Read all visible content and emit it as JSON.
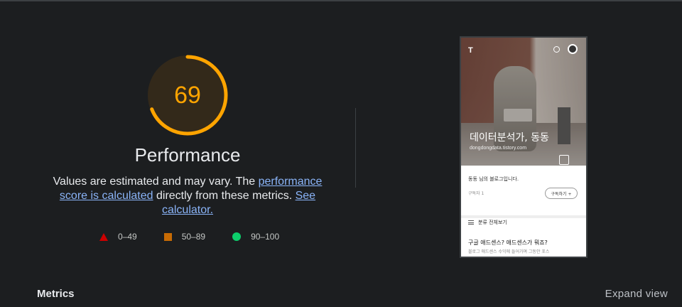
{
  "gauge": {
    "score": "69",
    "score_fraction": 0.69,
    "color": "#ffa400"
  },
  "category": {
    "title": "Performance"
  },
  "description": {
    "text_before": "Values are estimated and may vary. The ",
    "link1": "performance score is calculated",
    "text_middle": " directly from these metrics. ",
    "link2": "See calculator."
  },
  "legend": [
    {
      "label": "0–49",
      "icon": "red-triangle",
      "color": "#cc0000"
    },
    {
      "label": "50–89",
      "icon": "orange-square",
      "color": "#c76b04"
    },
    {
      "label": "90–100",
      "icon": "green-circle",
      "color": "#0cce6b"
    }
  ],
  "screenshot": {
    "logo": "T",
    "blog_title": "데이터분석가, 동동",
    "blog_url": "dongdongdata.tistory.com",
    "intro": "동동 님의 블로그입니다.",
    "subscribers": "구독자 1",
    "subscribe_button": "구독하기 +",
    "category_label": "분류 전체보기",
    "post_title": "구글 애드센스? 애드센스가 뭐죠?",
    "post_excerpt": "블로그 애드센스 수익에 들어가며 그동안 포스"
  },
  "footer": {
    "metrics_label": "Metrics",
    "expand_label": "Expand view"
  }
}
